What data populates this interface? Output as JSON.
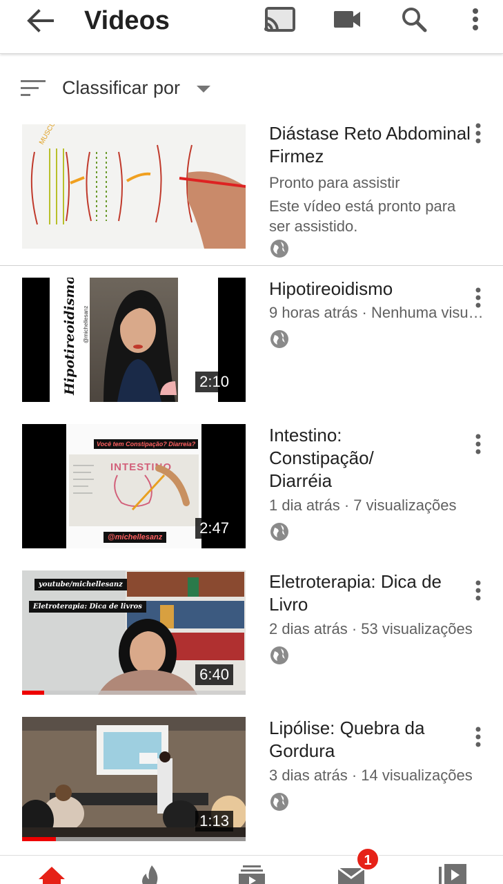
{
  "header": {
    "title": "Videos",
    "icons": [
      "arrow-back-icon",
      "cast-icon",
      "video-camera-icon",
      "search-icon",
      "more-vert-icon"
    ]
  },
  "sort": {
    "label": "Classificar por"
  },
  "videos": [
    {
      "title": "Diástase Reto Abdominal Firmez",
      "status": "Pronto para assistir",
      "description": "Este vídeo está pronto para ser assistido.",
      "duration": "",
      "visibility": "public"
    },
    {
      "title": "Hipotireoidismo",
      "meta": "9 horas atrás · Nenhuma visu…",
      "duration": "2:10",
      "thumb_text": "Hipotireoidismo",
      "thumb_handle": "@michellesanz",
      "visibility": "public"
    },
    {
      "title": "Intestino: Constipação/ Diarréia",
      "meta": "1 dia atrás · 7 visualizações",
      "duration": "2:47",
      "thumb_question": "Você tem Constipação? Diarreia?",
      "thumb_handle": "@michellesanz",
      "thumb_board": "INTESTINO",
      "visibility": "public"
    },
    {
      "title": "Eletroterapia: Dica de Livro",
      "meta": "2 dias atrás · 53 visualizações",
      "duration": "6:40",
      "thumb_tag1": "youtube/michellesanz",
      "thumb_tag2": "Eletroterapia: Dica de livros",
      "watched_fraction": 0.1,
      "visibility": "public"
    },
    {
      "title": "Lipólise: Quebra da Gordura",
      "meta": "3 dias atrás · 14 visualizações",
      "duration": "1:13",
      "watched_fraction": 0.15,
      "visibility": "public"
    }
  ],
  "bottom_nav": {
    "items": [
      "home-icon",
      "trending-icon",
      "subscriptions-icon",
      "inbox-icon",
      "library-icon"
    ],
    "inbox_badge": "1"
  },
  "colors": {
    "accent": "#e62117",
    "text": "#212121",
    "secondary": "#606060"
  }
}
